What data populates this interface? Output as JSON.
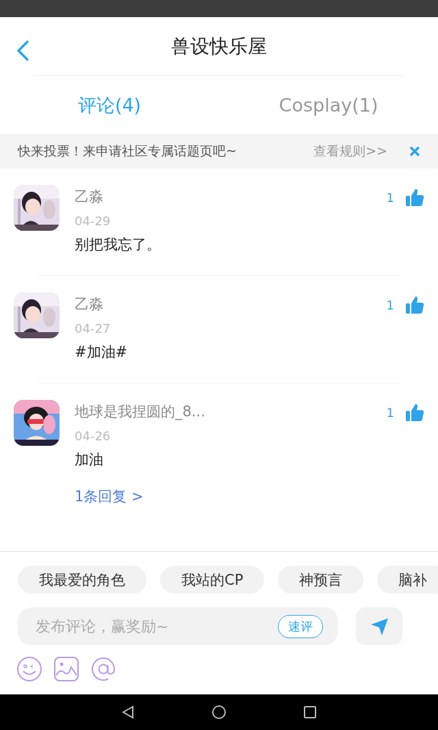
{
  "header": {
    "title": "兽设快乐屋"
  },
  "tabs": [
    {
      "label": "评论(4)",
      "selected": true
    },
    {
      "label": "Cosplay(1)",
      "selected": false
    }
  ],
  "notice": {
    "text": "快来投票！来申请社区专属话题页吧~",
    "link": "查看规则>>"
  },
  "comments": [
    {
      "author": "乙淼",
      "date": "04-29",
      "text": "别把我忘了。",
      "likes": "1"
    },
    {
      "author": "乙淼",
      "date": "04-27",
      "text": "#加油#",
      "likes": "1"
    },
    {
      "author": "地球是我捏圆的_8...",
      "date": "04-26",
      "text": "加油",
      "likes": "1",
      "replies": "1条回复 >"
    }
  ],
  "chips": [
    "我最爱的角色",
    "我站的CP",
    "神预言",
    "脑补"
  ],
  "composer": {
    "placeholder": "发布评论，赢奖励~",
    "quick": "速评"
  }
}
